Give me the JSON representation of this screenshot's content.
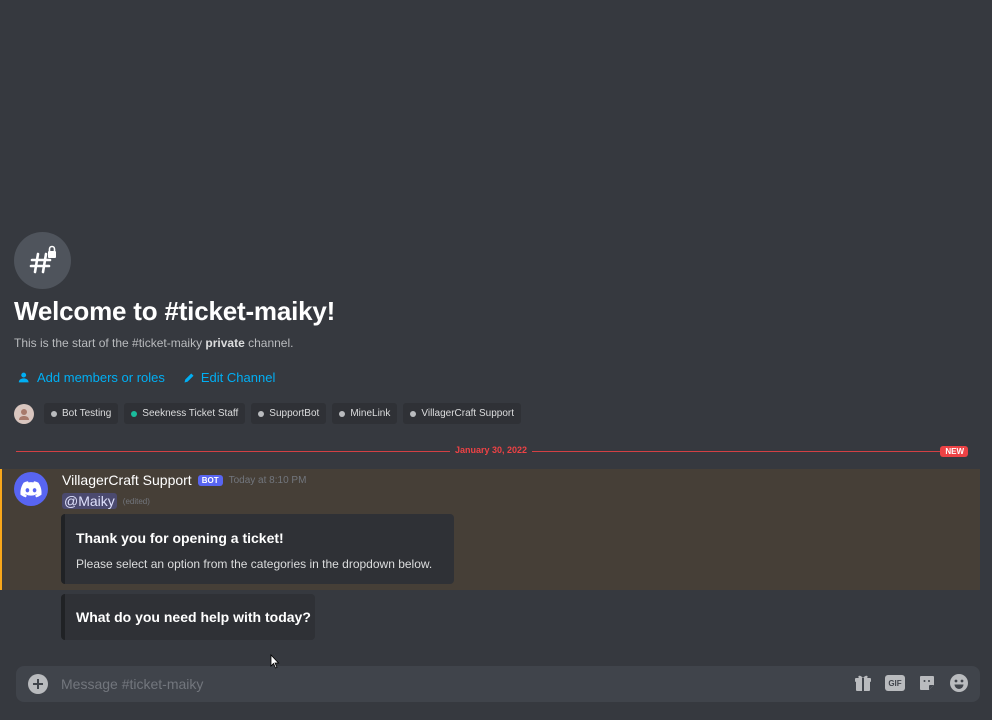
{
  "welcome": {
    "title": "Welcome to #ticket-maiky!",
    "subtitle_start": "This is the start of the #ticket-maiky ",
    "subtitle_bold": "private",
    "subtitle_end": " channel.",
    "actions": [
      {
        "label": "Add members or roles",
        "icon": "person-add-icon"
      },
      {
        "label": "Edit Channel",
        "icon": "pencil-icon"
      }
    ]
  },
  "roles": [
    {
      "label": "Bot Testing",
      "color": "#b9bbbe"
    },
    {
      "label": "Seekness Ticket Staff",
      "color": "#1abc9c"
    },
    {
      "label": "SupportBot",
      "color": "#b9bbbe"
    },
    {
      "label": "MineLink",
      "color": "#b9bbbe"
    },
    {
      "label": "VillagerCraft Support",
      "color": "#b9bbbe"
    }
  ],
  "divider": {
    "date": "January 30, 2022",
    "new_label": "NEW"
  },
  "message": {
    "author": "VillagerCraft Support",
    "bot_tag": "BOT",
    "timestamp": "Today at 8:10 PM",
    "mention": "@Maiky",
    "edited": "(edited)",
    "embeds": [
      {
        "title": "Thank you for opening a ticket!",
        "description": "Please select an option from the categories in the dropdown below."
      },
      {
        "title": "What do you need help with today?"
      }
    ]
  },
  "composer": {
    "placeholder": "Message #ticket-maiky",
    "tools": [
      "gift-icon",
      "gif-icon",
      "sticker-icon",
      "emoji-icon"
    ],
    "gif_label": "GIF"
  },
  "colors": {
    "background": "#36393f",
    "link": "#00aff4",
    "new_red": "#ed4245",
    "mention_highlight": "#faa81a",
    "blurple": "#5865f2"
  }
}
